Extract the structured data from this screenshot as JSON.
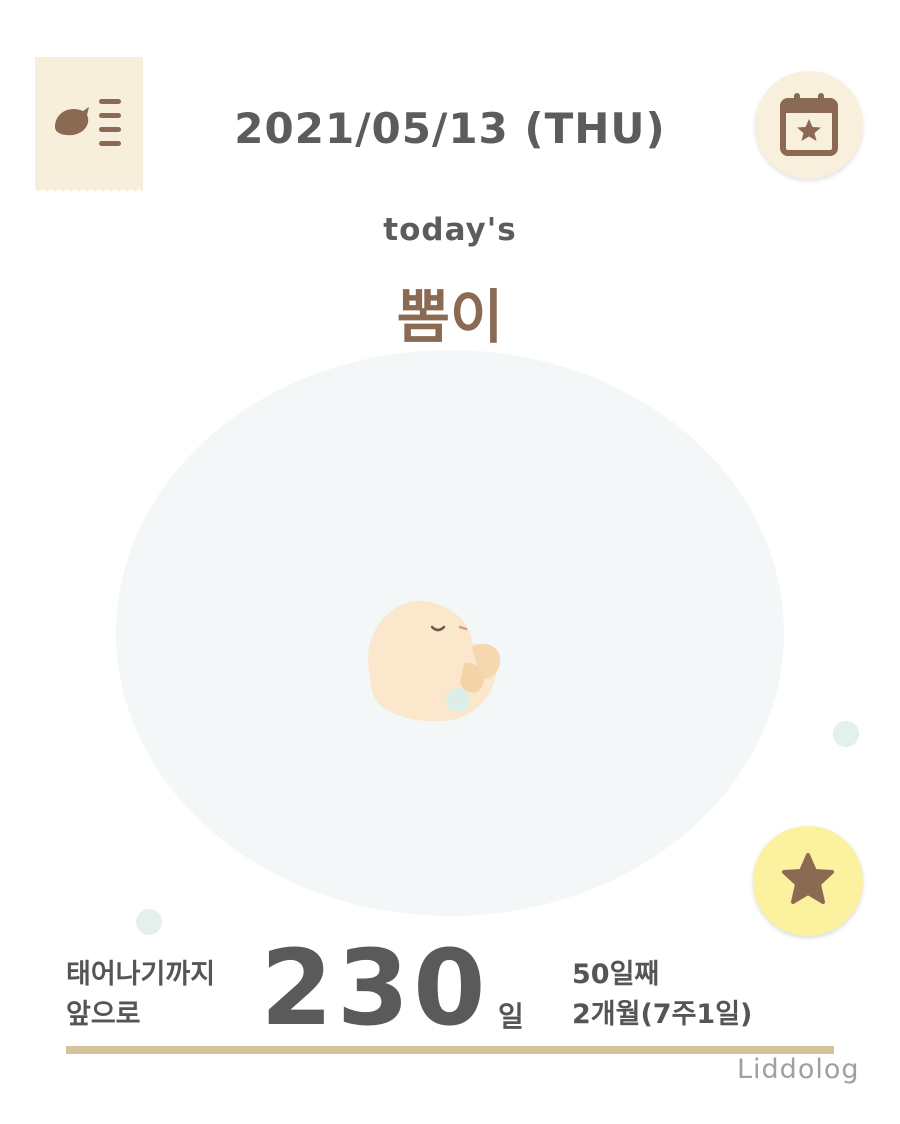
{
  "header": {
    "date": "2021/05/13 (THU)",
    "menu_icon": "bird-list-icon",
    "calendar_icon": "calendar-star-icon"
  },
  "main": {
    "todays_label": "today's",
    "baby_name": "뽐이",
    "illustration": "fetus-icon"
  },
  "fab": {
    "icon": "star-icon"
  },
  "stats": {
    "until_birth_line1": "태어나기까지",
    "until_birth_line2": "앞으로",
    "days_remaining": "230",
    "days_unit": "일",
    "day_count": "50일째",
    "age": "2개월(7주1일)"
  },
  "progress": {
    "fraction": 1.0
  },
  "watermark": "Liddolog",
  "colors": {
    "accent_brown": "#8a6a52",
    "tag_bg": "#f7eedb",
    "star_button_bg": "#fbf19e",
    "progress_bar": "#d6c29a",
    "womb_bg": "#f3f7f8"
  }
}
